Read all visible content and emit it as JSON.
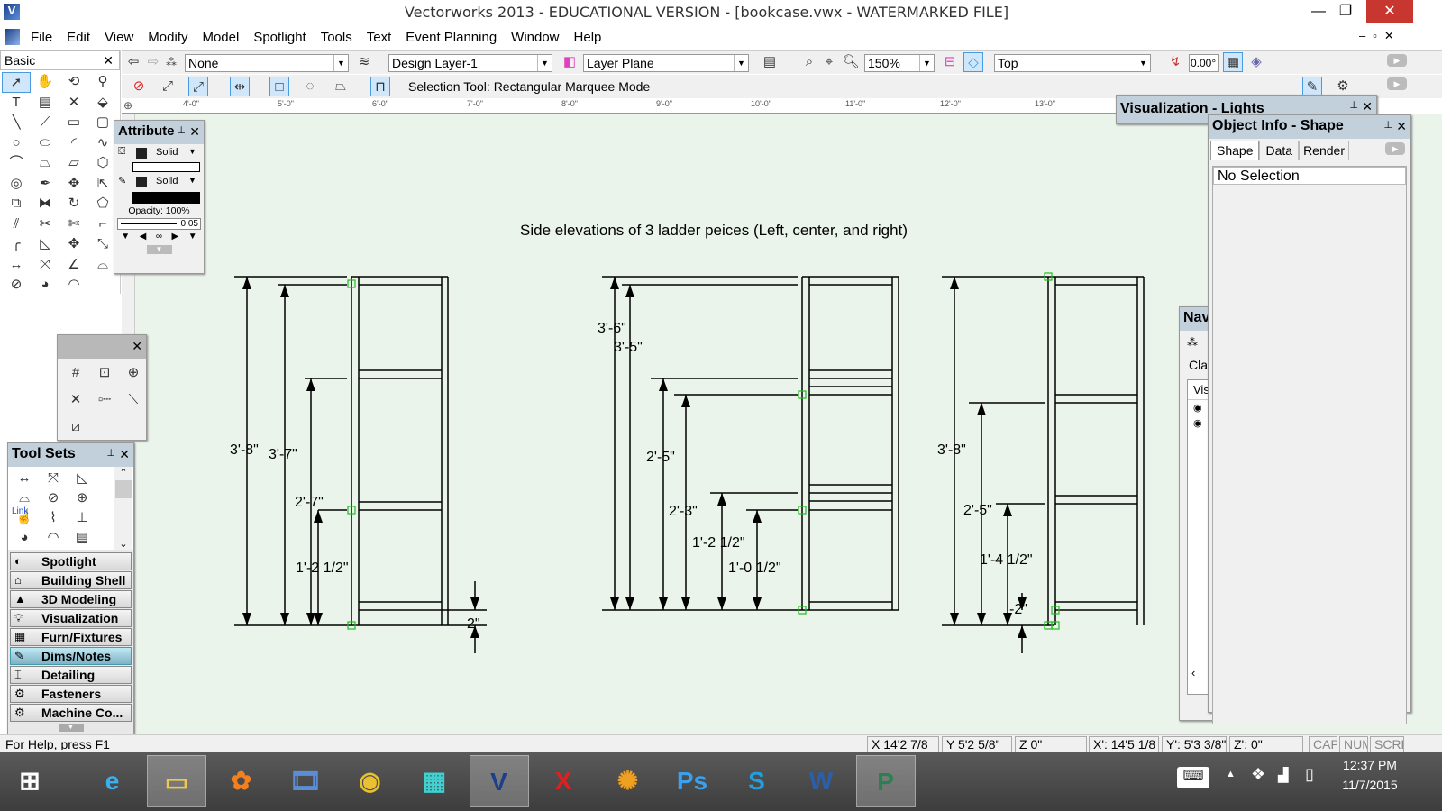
{
  "window": {
    "title": "Vectorworks 2013 - EDUCATIONAL VERSION - [bookcase.vwx - WATERMARKED FILE]"
  },
  "menu": [
    "File",
    "Edit",
    "View",
    "Modify",
    "Model",
    "Spotlight",
    "Tools",
    "Text",
    "Event Planning",
    "Window",
    "Help"
  ],
  "view_bar": {
    "class": "None",
    "layer": "Design Layer-1",
    "plane": "Layer Plane",
    "zoom": "150%",
    "view": "Top",
    "angle": "0.00°"
  },
  "mode_bar": {
    "message": "Selection Tool: Rectangular Marquee Mode"
  },
  "ruler": [
    "4'-0\"",
    "5'-0\"",
    "6'-0\"",
    "7'-0\"",
    "8'-0\"",
    "9'-0\"",
    "10'-0\"",
    "11'-0\"",
    "12'-0\"",
    "13'-0\""
  ],
  "basic_palette": {
    "title": "Basic",
    "tools": [
      "selection-icon",
      "pan-icon",
      "flyover-icon",
      "zoom-icon",
      "text-icon",
      "callout-icon",
      "locus-icon",
      "symbol-insert-icon",
      "line-icon",
      "double-line-icon",
      "rectangle-icon",
      "rounded-rectangle-icon",
      "circle-icon",
      "oval-icon",
      "arc-icon",
      "freehand-icon",
      "polyline-icon",
      "polygon-icon",
      "double-polygon-icon",
      "regular-polygon-icon",
      "spiral-icon",
      "eyedropper-icon",
      "attribute-mapping-icon",
      "visibility-icon",
      "clip-icon",
      "mirror-icon",
      "rotate-icon",
      "reshape-icon",
      "offset-icon",
      "trim-icon",
      "split-icon",
      "connect-icon",
      "fillet-icon",
      "chamfer-icon",
      "move-icon",
      "resize-icon",
      "dimension-icon",
      "angular-dim-icon",
      "angle-dim-icon",
      "arc-length-icon",
      "radial-dim-icon",
      "tape-measure-icon",
      "protractor-icon"
    ]
  },
  "attribute_palette": {
    "title": "Attribute",
    "fill_style": "Solid",
    "pen_style": "Solid",
    "opacity": "Opacity: 100%",
    "line_weight": "0.05"
  },
  "snap_palette": {
    "tools": [
      "snap-grid-icon",
      "snap-object-icon",
      "snap-intersection-icon",
      "snap-distance-icon",
      "snap-tangent-icon",
      "snap-surface-icon",
      "snap-working-plane-icon"
    ]
  },
  "tool_sets": {
    "title": "Tool Sets",
    "tools": [
      "dimension-icon",
      "angular-dim-icon",
      "arc-dim-icon",
      "chain-dim-icon",
      "radial-dim-icon",
      "center-mark-icon",
      "hyperlink-icon",
      "break-line-icon",
      "datum-icon",
      "tape-measure-icon",
      "protractor-icon",
      "callout-icon"
    ],
    "link_label": "Link",
    "sets": [
      {
        "label": "Spotlight",
        "icon": "spotlight-icon"
      },
      {
        "label": "Building Shell",
        "icon": "house-icon"
      },
      {
        "label": "3D Modeling",
        "icon": "shapes-icon"
      },
      {
        "label": "Visualization",
        "icon": "bulb-icon"
      },
      {
        "label": "Furn/Fixtures",
        "icon": "furniture-icon"
      },
      {
        "label": "Dims/Notes",
        "icon": "pencil-ruler-icon",
        "selected": true
      },
      {
        "label": "Detailing",
        "icon": "ibeam-icon"
      },
      {
        "label": "Fasteners",
        "icon": "bolt-icon"
      },
      {
        "label": "Machine Co...",
        "icon": "gear-icon"
      }
    ]
  },
  "vis_lights": {
    "title": "Visualization - Lights"
  },
  "object_info": {
    "title": "Object Info - Shape",
    "tabs": [
      "Shape",
      "Data",
      "Render"
    ],
    "active_tab": "Shape",
    "selection": "No Selection"
  },
  "navigation": {
    "title": "Nav",
    "class_label": "Cla",
    "vis_label": "Vis"
  },
  "drawing": {
    "title": "Side elevations of 3 ladder peices (Left, center, and right)",
    "left": {
      "dims": [
        "3'-8\"",
        "3'-7\"",
        "2'-7\"",
        "1'-2 1/2\"",
        "2\""
      ]
    },
    "center": {
      "dims": [
        "3'-6\"",
        "3'-5\"",
        "2'-5\"",
        "2'-3\"",
        "1'-2 1/2\"",
        "1'-0 1/2\""
      ]
    },
    "right": {
      "dims": [
        "3'-8\"",
        "2'-5\"",
        "1'-4 1/2\"",
        "-2\""
      ]
    }
  },
  "status": {
    "help": "For Help, press F1",
    "x": "X 14'2 7/8",
    "y": "Y 5'2 5/8\"",
    "z": "Z 0\"",
    "x2": "X': 14'5 1/8",
    "y2": "Y': 5'3 3/8\"",
    "z2": "Z': 0\"",
    "cap": "CAP",
    "num": "NUM",
    "scrl": "SCRL"
  },
  "taskbar": {
    "apps": [
      {
        "name": "start",
        "glyph": "⊞"
      },
      {
        "name": "internet-explorer",
        "glyph": "e"
      },
      {
        "name": "file-explorer",
        "glyph": "▭"
      },
      {
        "name": "photo-gallery",
        "glyph": "✿"
      },
      {
        "name": "movie-maker",
        "glyph": "🎞"
      },
      {
        "name": "chrome",
        "glyph": "◉"
      },
      {
        "name": "app-blocks",
        "glyph": "▦"
      },
      {
        "name": "vectorworks",
        "glyph": "V"
      },
      {
        "name": "acrobat",
        "glyph": "X"
      },
      {
        "name": "app-orange",
        "glyph": "✺"
      },
      {
        "name": "photoshop",
        "glyph": "Ps"
      },
      {
        "name": "skype",
        "glyph": "S"
      },
      {
        "name": "word",
        "glyph": "W"
      },
      {
        "name": "project",
        "glyph": "P"
      }
    ],
    "time": "12:37 PM",
    "date": "11/7/2015"
  },
  "colors": {
    "canvas": "#eaf4ea",
    "panel_header": "#c2d0dc",
    "snap_green": "#22bb22",
    "selected_tool": "#cfe6fb"
  }
}
